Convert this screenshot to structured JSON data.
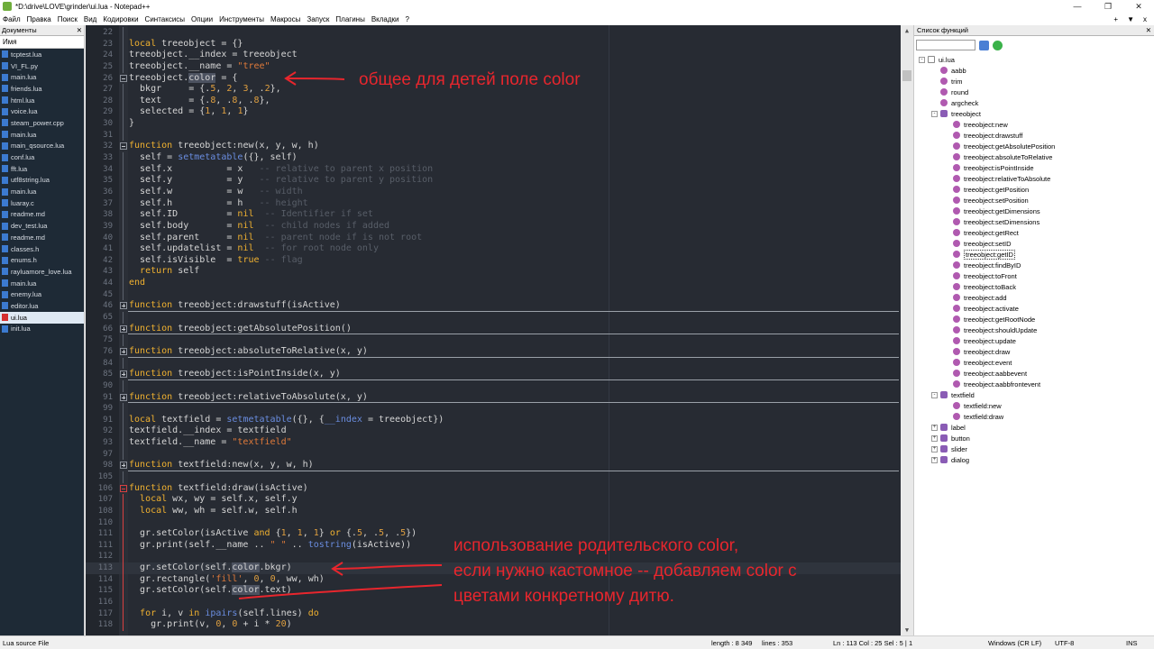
{
  "window": {
    "title": "*D:\\drive\\LOVE\\grinder\\ui.lua - Notepad++"
  },
  "menu": {
    "items": [
      "Файл",
      "Правка",
      "Поиск",
      "Вид",
      "Кодировки",
      "Синтаксисы",
      "Опции",
      "Инструменты",
      "Макросы",
      "Запуск",
      "Плагины",
      "Вкладки",
      "?"
    ],
    "right": [
      "+",
      "▼",
      "x"
    ]
  },
  "docs_panel": {
    "title": "Документы",
    "column": "Имя",
    "files": [
      "tcptest.lua",
      "VI_FL.py",
      "main.lua",
      "friends.lua",
      "html.lua",
      "voice.lua",
      "steam_power.cpp",
      "main.lua",
      "main_qsource.lua",
      "conf.lua",
      "fft.lua",
      "utf8string.lua",
      "main.lua",
      "luaray.c",
      "readme.md",
      "dev_test.lua",
      "readme.md",
      "classes.h",
      "enums.h",
      "rayluamore_love.lua",
      "main.lua",
      "enemy.lua",
      "editor.lua",
      "ui.lua",
      "init.lua"
    ],
    "active_file": "ui.lua"
  },
  "editor": {
    "lines": [
      {
        "n": "22",
        "fold": "bar",
        "html": ""
      },
      {
        "n": "23",
        "fold": "bar",
        "html": "<span class='k'>local</span> treeobject = {}"
      },
      {
        "n": "24",
        "fold": "bar",
        "html": "treeobject.__index = treeobject"
      },
      {
        "n": "25",
        "fold": "bar",
        "html": "treeobject.__name = <span class='s'>\"tree\"</span>"
      },
      {
        "n": "26",
        "fold": "box",
        "html": "treeobject.<span class='hl'>color</span> = {"
      },
      {
        "n": "27",
        "fold": "bar",
        "html": "  bkgr     = {.<span class='n'>5</span>, <span class='n'>2</span>, <span class='n'>3</span>, .<span class='n'>2</span>},"
      },
      {
        "n": "28",
        "fold": "bar",
        "html": "  text     = {.<span class='n'>8</span>, .<span class='n'>8</span>, .<span class='n'>8</span>},"
      },
      {
        "n": "29",
        "fold": "bar",
        "html": "  selected = {<span class='n'>1</span>, <span class='n'>1</span>, <span class='n'>1</span>}"
      },
      {
        "n": "30",
        "fold": "bar",
        "html": "}"
      },
      {
        "n": "31",
        "fold": "bar",
        "html": ""
      },
      {
        "n": "32",
        "fold": "box",
        "html": "<span class='k'>function</span> treeobject:new(x, y, w, h)"
      },
      {
        "n": "33",
        "fold": "bar",
        "html": "  self = <span class='f'>setmetatable</span>({}, self)"
      },
      {
        "n": "34",
        "fold": "bar",
        "html": "  self.x          = x   <span class='c'>-- relative to parent x position</span>"
      },
      {
        "n": "35",
        "fold": "bar",
        "html": "  self.y          = y   <span class='c'>-- relative to parent y position</span>"
      },
      {
        "n": "36",
        "fold": "bar",
        "html": "  self.w          = w   <span class='c'>-- width</span>"
      },
      {
        "n": "37",
        "fold": "bar",
        "html": "  self.h          = h   <span class='c'>-- height</span>"
      },
      {
        "n": "38",
        "fold": "bar",
        "html": "  self.ID         = <span class='k'>nil</span>  <span class='c'>-- Identifier if set</span>"
      },
      {
        "n": "39",
        "fold": "bar",
        "html": "  self.body       = <span class='k'>nil</span>  <span class='c'>-- child nodes if added</span>"
      },
      {
        "n": "40",
        "fold": "bar",
        "html": "  self.parent     = <span class='k'>nil</span>  <span class='c'>-- parent node if is not root</span>"
      },
      {
        "n": "41",
        "fold": "bar",
        "html": "  self.updatelist = <span class='k'>nil</span>  <span class='c'>-- for root node only</span>"
      },
      {
        "n": "42",
        "fold": "bar",
        "html": "  self.isVisible  = <span class='k'>true</span> <span class='c'>-- flag</span>"
      },
      {
        "n": "43",
        "fold": "bar",
        "html": "  <span class='k'>return</span> self"
      },
      {
        "n": "44",
        "fold": "bar",
        "html": "<span class='k'>end</span>"
      },
      {
        "n": "45",
        "fold": "bar",
        "html": ""
      },
      {
        "n": "46",
        "fold": "plus",
        "folded": true,
        "html": "<span class='k'>function</span> treeobject:drawstuff(isActive)"
      },
      {
        "n": "65",
        "fold": "bar",
        "html": ""
      },
      {
        "n": "66",
        "fold": "plus",
        "folded": true,
        "html": "<span class='k'>function</span> treeobject:getAbsolutePosition()"
      },
      {
        "n": "75",
        "fold": "bar",
        "html": ""
      },
      {
        "n": "76",
        "fold": "plus",
        "folded": true,
        "html": "<span class='k'>function</span> treeobject:absoluteToRelative(x, y)"
      },
      {
        "n": "84",
        "fold": "bar",
        "html": ""
      },
      {
        "n": "85",
        "fold": "plus",
        "folded": true,
        "html": "<span class='k'>function</span> treeobject:isPointInside(x, y)"
      },
      {
        "n": "90",
        "fold": "bar",
        "html": ""
      },
      {
        "n": "91",
        "fold": "plus",
        "folded": true,
        "html": "<span class='k'>function</span> treeobject:relativeToAbsolute(x, y)"
      },
      {
        "n": "99",
        "fold": "bar",
        "html": ""
      },
      {
        "n": "91",
        "fold": "bar",
        "html": "<span class='k'>local</span> textfield = <span class='f'>setmetatable</span>({}, {<span class='f'>__index</span> = treeobject})"
      },
      {
        "n": "92",
        "fold": "bar",
        "html": "textfield.__index = textfield"
      },
      {
        "n": "93",
        "fold": "bar",
        "html": "textfield.__name = <span class='s'>\"textfield\"</span>"
      },
      {
        "n": "97",
        "fold": "bar",
        "html": ""
      },
      {
        "n": "98",
        "fold": "plus",
        "folded": true,
        "html": "<span class='k'>function</span> textfield:new(x, y, w, h)"
      },
      {
        "n": "105",
        "fold": "bar",
        "html": ""
      },
      {
        "n": "106",
        "fold": "boxred",
        "html": "<span class='k'>function</span> textfield:draw(isActive)"
      },
      {
        "n": "107",
        "fold": "redbar",
        "html": "  <span class='k'>local</span> wx, wy = self.x, self.y"
      },
      {
        "n": "108",
        "fold": "redbar",
        "html": "  <span class='k'>local</span> ww, wh = self.w, self.h"
      },
      {
        "n": "110",
        "fold": "redbar",
        "html": ""
      },
      {
        "n": "111",
        "fold": "redbar",
        "html": "  gr.setColor(isActive <span class='k'>and</span> {<span class='n'>1</span>, <span class='n'>1</span>, <span class='n'>1</span>} <span class='k'>or</span> {.<span class='n'>5</span>, .<span class='n'>5</span>, .<span class='n'>5</span>})"
      },
      {
        "n": "111",
        "fold": "redbar",
        "html": "  gr.print(self.__name .. <span class='s'>\" \"</span> .. <span class='f'>tostring</span>(isActive))"
      },
      {
        "n": "112",
        "fold": "redbar",
        "html": ""
      },
      {
        "n": "113",
        "fold": "redbar",
        "current": true,
        "html": "  gr.setColor(self.<span class='hl'>color</span>.bkgr)"
      },
      {
        "n": "114",
        "fold": "redbar",
        "html": "  gr.rectangle(<span class='s'>'fill'</span>, <span class='n'>0</span>, <span class='n'>0</span>, ww, wh)"
      },
      {
        "n": "115",
        "fold": "redbar",
        "html": "  gr.setColor(self.<span class='hl'>color</span>.text)"
      },
      {
        "n": "116",
        "fold": "redbar",
        "html": ""
      },
      {
        "n": "117",
        "fold": "redbar",
        "html": "  <span class='k'>for</span> i, v <span class='k'>in</span> <span class='f'>ipairs</span>(self.lines) <span class='k'>do</span>"
      },
      {
        "n": "118",
        "fold": "redbar",
        "html": "    gr.print(v, <span class='n'>0</span>, <span class='n'>0</span> + i * <span class='n'>20</span>)"
      }
    ],
    "annotation1": "общее для детей поле color",
    "annotation2": [
      "использование родительского color,",
      "если нужно кастомное -- добавляем color с",
      "цветами конкретному дитю."
    ]
  },
  "func_panel": {
    "title": "Список функций",
    "items": [
      {
        "level": 0,
        "type": "file",
        "exp": "-",
        "label": "ui.lua"
      },
      {
        "level": 1,
        "type": "fn",
        "label": "aabb"
      },
      {
        "level": 1,
        "type": "fn",
        "label": "trim"
      },
      {
        "level": 1,
        "type": "fn",
        "label": "round"
      },
      {
        "level": 1,
        "type": "fn",
        "label": "argcheck"
      },
      {
        "level": 1,
        "type": "cls",
        "exp": "-",
        "label": "treeobject"
      },
      {
        "level": 2,
        "type": "fn",
        "label": "treeobject:new"
      },
      {
        "level": 2,
        "type": "fn",
        "label": "treeobject:drawstuff"
      },
      {
        "level": 2,
        "type": "fn",
        "label": "treeobject:getAbsolutePosition"
      },
      {
        "level": 2,
        "type": "fn",
        "label": "treeobject:absoluteToRelative"
      },
      {
        "level": 2,
        "type": "fn",
        "label": "treeobject:isPointInside"
      },
      {
        "level": 2,
        "type": "fn",
        "label": "treeobject:relativeToAbsolute"
      },
      {
        "level": 2,
        "type": "fn",
        "label": "treeobject:getPosition"
      },
      {
        "level": 2,
        "type": "fn",
        "label": "treeobject:setPosition"
      },
      {
        "level": 2,
        "type": "fn",
        "label": "treeobject:getDimensions"
      },
      {
        "level": 2,
        "type": "fn",
        "label": "treeobject:setDimensions"
      },
      {
        "level": 2,
        "type": "fn",
        "label": "treeobject:getRect"
      },
      {
        "level": 2,
        "type": "fn",
        "label": "treeobject:setID"
      },
      {
        "level": 2,
        "type": "fn",
        "label": "treeobject:getID",
        "selected": true
      },
      {
        "level": 2,
        "type": "fn",
        "label": "treeobject:findByID"
      },
      {
        "level": 2,
        "type": "fn",
        "label": "treeobject:toFront"
      },
      {
        "level": 2,
        "type": "fn",
        "label": "treeobject:toBack"
      },
      {
        "level": 2,
        "type": "fn",
        "label": "treeobject:add"
      },
      {
        "level": 2,
        "type": "fn",
        "label": "treeobject:activate"
      },
      {
        "level": 2,
        "type": "fn",
        "label": "treeobject:getRootNode"
      },
      {
        "level": 2,
        "type": "fn",
        "label": "treeobject:shouldUpdate"
      },
      {
        "level": 2,
        "type": "fn",
        "label": "treeobject:update"
      },
      {
        "level": 2,
        "type": "fn",
        "label": "treeobject:draw"
      },
      {
        "level": 2,
        "type": "fn",
        "label": "treeobject:event"
      },
      {
        "level": 2,
        "type": "fn",
        "label": "treeobject:aabbevent"
      },
      {
        "level": 2,
        "type": "fn",
        "label": "treeobject:aabbfrontevent"
      },
      {
        "level": 1,
        "type": "cls",
        "exp": "-",
        "label": "textfield"
      },
      {
        "level": 2,
        "type": "fn",
        "label": "textfield:new"
      },
      {
        "level": 2,
        "type": "fn",
        "label": "textfield:draw"
      },
      {
        "level": 1,
        "type": "cls",
        "exp": "+",
        "label": "label"
      },
      {
        "level": 1,
        "type": "cls",
        "exp": "+",
        "label": "button"
      },
      {
        "level": 1,
        "type": "cls",
        "exp": "+",
        "label": "slider"
      },
      {
        "level": 1,
        "type": "cls",
        "exp": "+",
        "label": "dialog"
      }
    ]
  },
  "status": {
    "type": "Lua source File",
    "length": "length : 8 349",
    "lines": "lines : 353",
    "pos": "Ln : 113    Col : 25    Sel : 5 | 1",
    "eol": "Windows (CR LF)",
    "encoding": "UTF-8",
    "mode": "INS"
  },
  "colors": {
    "editor_bg": "#272b33",
    "keyword": "#f0b130",
    "annotation": "#e8262d"
  }
}
